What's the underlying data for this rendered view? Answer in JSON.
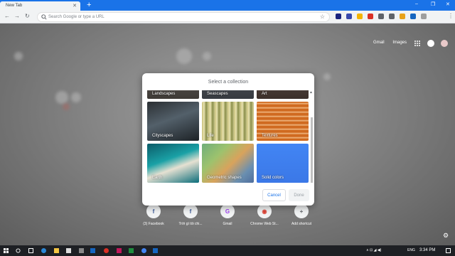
{
  "browser": {
    "tab_title": "New Tab",
    "tab_close": "✕",
    "new_tab": "+",
    "window_controls": [
      "–",
      "❐",
      "✕"
    ],
    "nav": {
      "back": "←",
      "forward": "→",
      "reload": "↻"
    },
    "omnibox_placeholder": "Search Google or type a URL",
    "star": "☆",
    "extensions": [
      {
        "name": "ext-1",
        "color": "#1a237e"
      },
      {
        "name": "ext-2",
        "color": "#3949ab"
      },
      {
        "name": "ext-3",
        "color": "#f4b400"
      },
      {
        "name": "ext-4",
        "color": "#d93025"
      },
      {
        "name": "ext-5",
        "color": "#5f6368"
      },
      {
        "name": "ext-6",
        "color": "#5f6368"
      },
      {
        "name": "ext-7",
        "color": "#e8a21a"
      },
      {
        "name": "ext-8",
        "color": "#1565c0"
      },
      {
        "name": "ext-9",
        "color": "#9e9e9e"
      }
    ],
    "menu": "⋮"
  },
  "ntp": {
    "links": {
      "gmail": "Gmail",
      "images": "Images"
    },
    "shortcuts": [
      {
        "label": "(3) Facebook",
        "glyph": "f",
        "color": "#3b5998"
      },
      {
        "label": "Trời gì tối chi...",
        "glyph": "f",
        "color": "#3b5998"
      },
      {
        "label": "Gmail",
        "glyph": "G",
        "color": "#a142f4"
      },
      {
        "label": "Chrome Web St...",
        "glyph": "◉",
        "color": "#db4437"
      },
      {
        "label": "Add shortcut",
        "glyph": "+",
        "color": "#5f6368"
      }
    ],
    "gear": "⚙"
  },
  "dialog": {
    "title": "Select a collection",
    "collections": [
      {
        "label": "Landscapes",
        "bg": "linear-gradient(180deg,#6d6a66,#3e3a36)"
      },
      {
        "label": "Seascapes",
        "bg": "linear-gradient(180deg,#5a5f66,#363a40)"
      },
      {
        "label": "Art",
        "bg": "linear-gradient(180deg,#6b5a52,#3b2f2a)"
      },
      {
        "label": "Cityscapes",
        "bg": "linear-gradient(160deg,#2b2f33 0%,#53606a 45%,#1d2226 100%)"
      },
      {
        "label": "Life",
        "bg": "repeating-linear-gradient(90deg,#c9c07a 0px,#e8e2b0 3px,#8a8e4a 6px,#c7c58a 9px)"
      },
      {
        "label": "Textures",
        "bg": "repeating-linear-gradient(0deg,#d06a20 0px,#d06a20 3px,#f3c08a 4px,#d06a20 6px),linear-gradient(180deg,#2a7bd1,#2a7bd1)"
      },
      {
        "label": "Earth",
        "bg": "linear-gradient(160deg,#0b5b68 0%,#1aa1a6 40%,#e6e1d2 60%,#0a6d7a 100%)"
      },
      {
        "label": "Geometric shapes",
        "bg": "linear-gradient(135deg,#6fae7a 0%,#9cc26e 30%,#d9a35c 55%,#6a8fb0 80%,#4e6d9c 100%)"
      },
      {
        "label": "Solid colors",
        "bg": "linear-gradient(180deg,#4285f4,#3b78e7)"
      }
    ],
    "cancel": "Cancel",
    "done": "Done"
  },
  "taskbar": {
    "time": "3:34 PM",
    "lang": "ENG",
    "tray": "∧ ⊡ ◢ ◀)"
  }
}
